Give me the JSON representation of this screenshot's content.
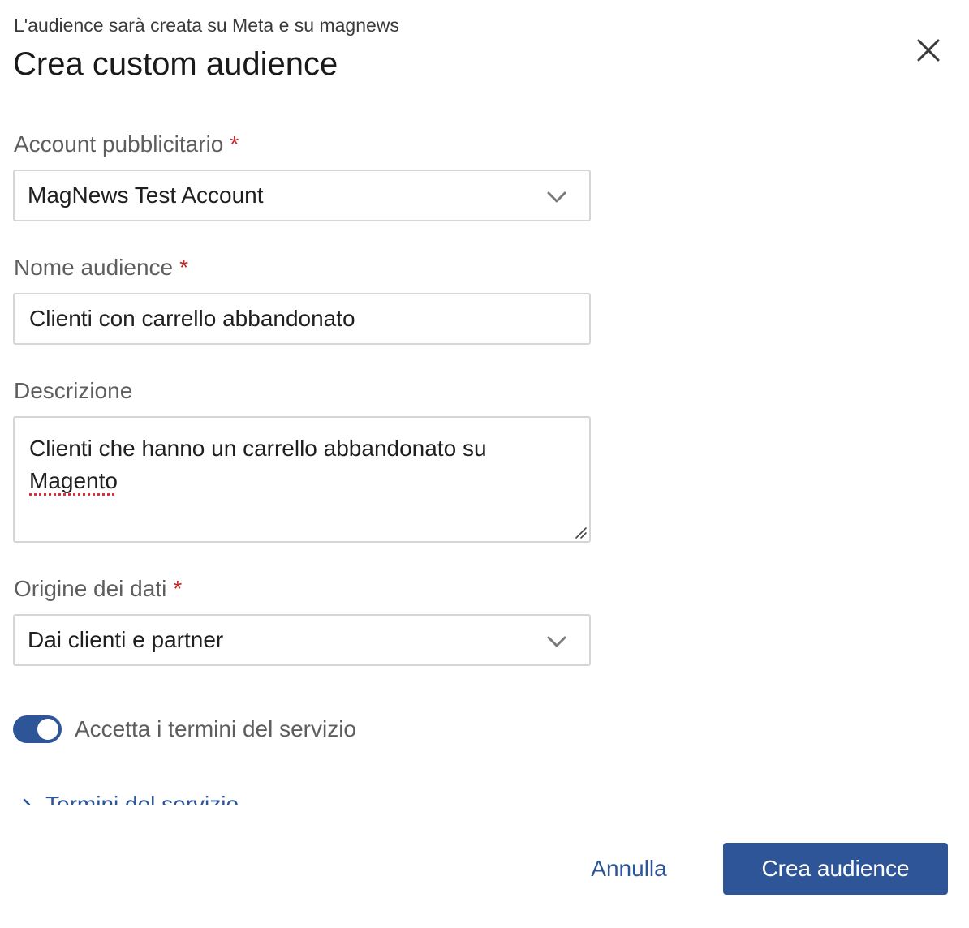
{
  "header": {
    "subtitle": "L'audience sarà creata su Meta e su magnews",
    "title": "Crea custom audience",
    "close_icon": "close-icon"
  },
  "form": {
    "ad_account": {
      "label": "Account pubblicitario",
      "required_mark": "*",
      "value": "MagNews Test Account"
    },
    "audience_name": {
      "label": "Nome audience",
      "required_mark": "*",
      "value": "Clienti con carrello abbandonato"
    },
    "description": {
      "label": "Descrizione",
      "value_line1": "Clienti che hanno un carrello abbandonato su",
      "value_line2": "Magento"
    },
    "data_origin": {
      "label": "Origine dei dati",
      "required_mark": "*",
      "value": "Dai clienti e partner"
    },
    "terms_toggle": {
      "label": "Accetta i termini del servizio",
      "checked": true
    },
    "terms_link": "Termini del servizio"
  },
  "footer": {
    "cancel_label": "Annulla",
    "submit_label": "Crea audience"
  },
  "colors": {
    "accent": "#2e5597",
    "required": "#c62828",
    "border": "#d6d6d6"
  }
}
